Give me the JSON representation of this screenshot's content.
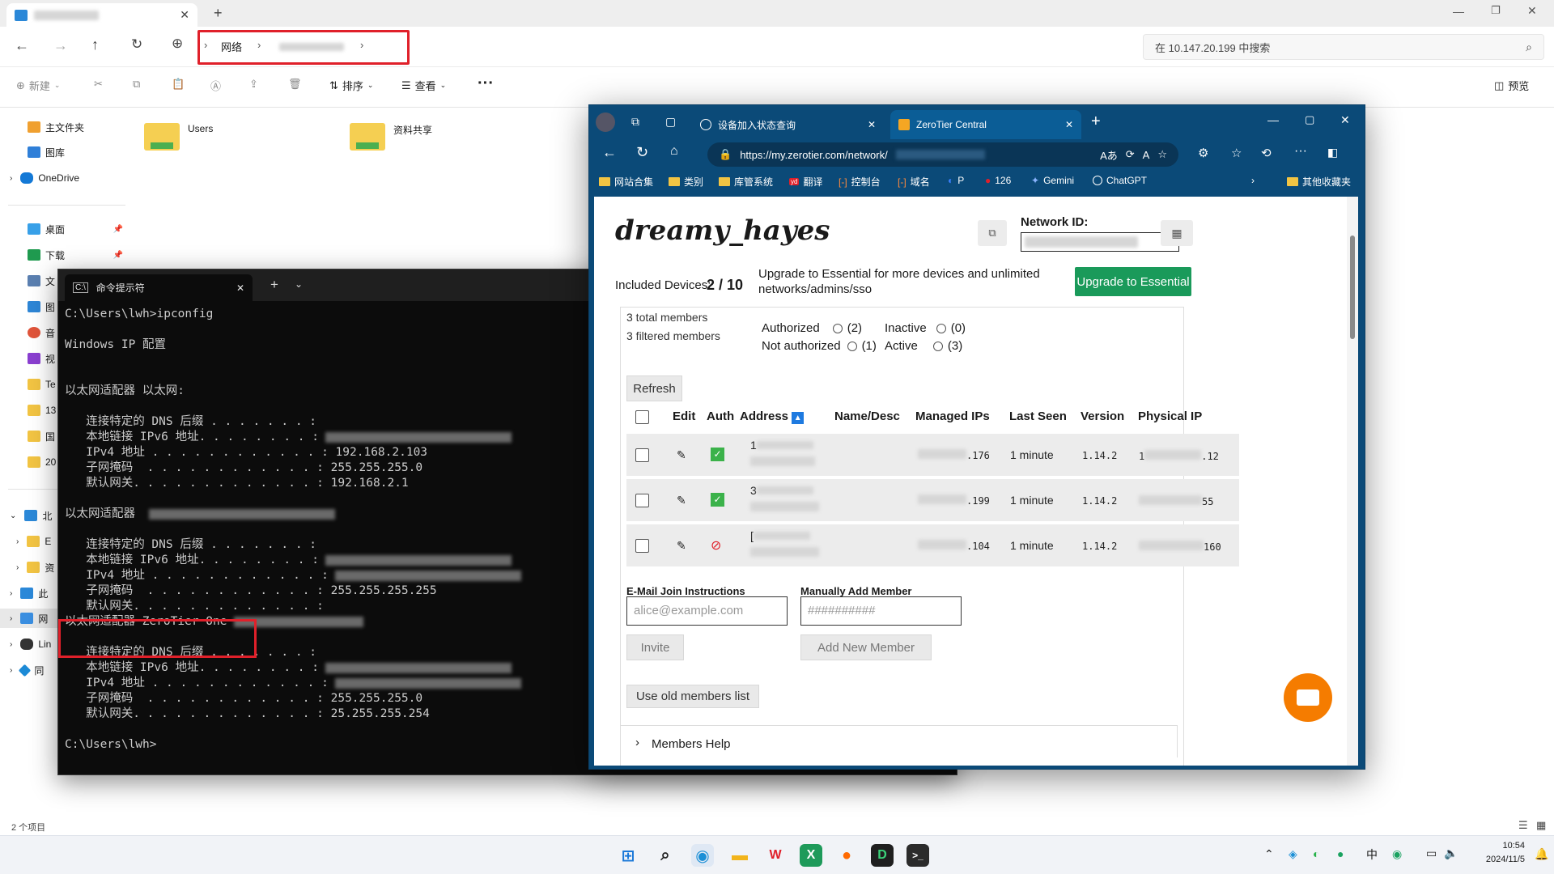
{
  "explorer": {
    "tab_title": "网络",
    "new_tab": "+",
    "breadcrumb": [
      "网络"
    ],
    "search_placeholder": "在 10.147.20.199 中搜索",
    "toolbar": {
      "new": "新建",
      "sort": "排序",
      "view": "查看",
      "more": "···",
      "preview": "预览"
    },
    "sidebar": {
      "home": "主文件夹",
      "gallery": "图库",
      "onedrive": "OneDrive",
      "pinned": [
        "桌面",
        "下载",
        "文",
        "图",
        "音",
        "视",
        "Te",
        "13",
        "国",
        "20"
      ],
      "tree": [
        "北",
        "E",
        "资",
        "此",
        "网",
        "Lin",
        "同"
      ]
    },
    "folders": [
      "Users",
      "资料共享"
    ],
    "status": "2 个项目"
  },
  "cmd": {
    "tab_title": "命令提示符",
    "lines": [
      {
        "t": "C:\\Users\\lwh>ipconfig"
      },
      {
        "t": ""
      },
      {
        "t": "Windows IP 配置"
      },
      {
        "t": ""
      },
      {
        "t": ""
      },
      {
        "t": "以太网适配器 以太网:"
      },
      {
        "t": ""
      },
      {
        "t": "   连接特定的 DNS 后缀 . . . . . . . :"
      },
      {
        "t": "   本地链接 IPv6 地址. . . . . . . . :",
        "r": true
      },
      {
        "t": "   IPv4 地址 . . . . . . . . . . . . : 192.168.2.103"
      },
      {
        "t": "   子网掩码  . . . . . . . . . . . . : 255.255.255.0"
      },
      {
        "t": "   默认网关. . . . . . . . . . . . . : 192.168.2.1"
      },
      {
        "t": ""
      },
      {
        "t": "以太网适配器 ",
        "r": true
      },
      {
        "t": ""
      },
      {
        "t": "   连接特定的 DNS 后缀 . . . . . . . :"
      },
      {
        "t": "   本地链接 IPv6 地址. . . . . . . . :",
        "r": true
      },
      {
        "t": "   IPv4 地址 . . . . . . . . . . . . :",
        "r": true
      },
      {
        "t": "   子网掩码  . . . . . . . . . . . . : 255.255.255.255"
      },
      {
        "t": "   默认网关. . . . . . . . . . . . . :"
      },
      {
        "t": "以太网适配器 ZeroTier One",
        "r": true,
        "hl": true
      },
      {
        "t": ""
      },
      {
        "t": "   连接特定的 DNS 后缀 . . . . . . . :"
      },
      {
        "t": "   本地链接 IPv6 地址. . . . . . . . :",
        "r": true
      },
      {
        "t": "   IPv4 地址 . . . . . . . . . . . . :",
        "r": true
      },
      {
        "t": "   子网掩码  . . . . . . . . . . . . : 255.255.255.0"
      },
      {
        "t": "   默认网关. . . . . . . . . . . . . : 25.255.255.254"
      },
      {
        "t": ""
      },
      {
        "t": "C:\\Users\\lwh>"
      }
    ]
  },
  "edge": {
    "tabs": [
      "设备加入状态查询",
      "ZeroTier Central"
    ],
    "url": "https://my.zerotier.com/network/",
    "bookmarks": [
      "网站合集",
      "类别",
      "库管系统",
      "翻译",
      "控制台",
      "域名",
      "P",
      "126",
      "Gemini",
      "ChatGPT",
      "其他收藏夹"
    ]
  },
  "zt": {
    "network_name": "dreamy_hayes",
    "network_id_label": "Network ID:",
    "included_label": "Included Devices:",
    "included_value": "2 / 10",
    "upgrade_text": "Upgrade to Essential for more devices and unlimited networks/admins/sso",
    "upgrade_button": "Upgrade to Essential",
    "total_members": "3 total members",
    "filtered_members": "3 filtered members",
    "filter_authorized": "Authorized",
    "filter_authorized_count": "(2)",
    "filter_not_authorized": "Not authorized",
    "filter_not_authorized_count": "(1)",
    "filter_inactive": "Inactive",
    "filter_inactive_count": "(0)",
    "filter_active": "Active",
    "filter_active_count": "(3)",
    "refresh": "Refresh",
    "columns": [
      "Edit",
      "Auth",
      "Address",
      "Name/Desc",
      "Managed IPs",
      "Last Seen",
      "Version",
      "Physical IP"
    ],
    "members": [
      {
        "auth": true,
        "addr_prefix": "1",
        "ip_suffix": ".176",
        "last_seen": "1 minute",
        "version": "1.14.2",
        "phys_prefix": "1",
        "phys_suffix": ".12"
      },
      {
        "auth": true,
        "addr_prefix": "3",
        "ip_suffix": ".199",
        "last_seen": "1 minute",
        "version": "1.14.2",
        "phys_prefix": "",
        "phys_suffix": "55"
      },
      {
        "auth": false,
        "addr_prefix": "[",
        "ip_suffix": ".104",
        "last_seen": "1 minute",
        "version": "1.14.2",
        "phys_prefix": "",
        "phys_suffix": "160"
      }
    ],
    "email_label": "E-Mail Join Instructions",
    "email_placeholder": "alice@example.com",
    "manual_label": "Manually Add Member",
    "manual_placeholder": "##########",
    "invite": "Invite",
    "add_member": "Add New Member",
    "old_list": "Use old members list",
    "members_help": "Members Help"
  },
  "taskbar": {
    "lang": "中",
    "time": "10:54",
    "date": "2024/11/5"
  },
  "colors": {
    "zt_green": "#1a9a5a",
    "edge_blue": "#0b4a78",
    "highlight_red": "#e0202a",
    "chat_orange": "#f57c00"
  }
}
